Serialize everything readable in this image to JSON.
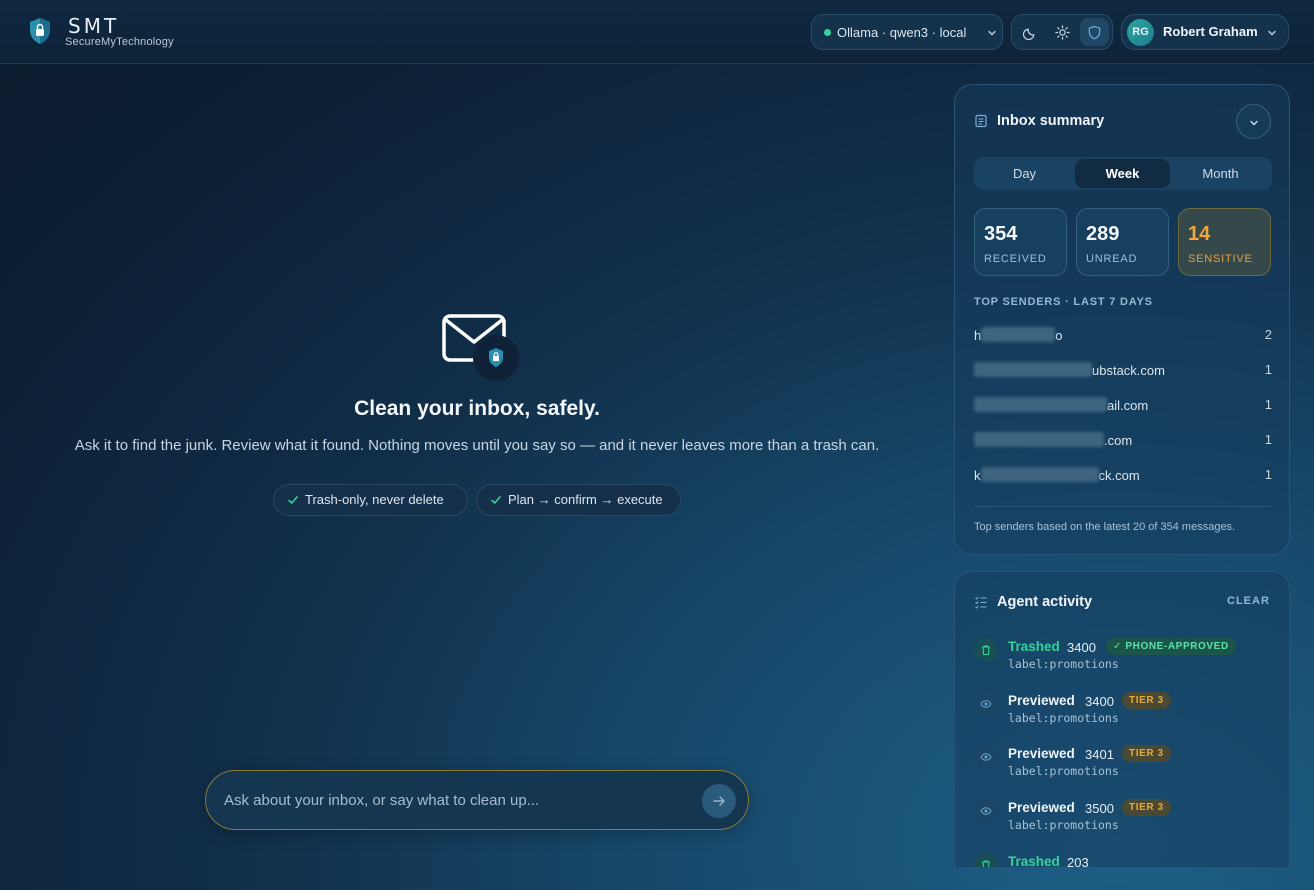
{
  "header": {
    "brand_name": "SMT",
    "brand_sub": "SecureMyTechnology",
    "model_status": "Ollama · qwen3 · local",
    "user_initials": "RG",
    "user_name": "Robert Graham"
  },
  "hero": {
    "title": "Clean your inbox, safely.",
    "subtitle": "Ask it to find the junk. Review what it found. Nothing moves until you say so — and it never leaves more than a trash can.",
    "chips": [
      "Trash-only, never delete",
      "Plan → confirm → execute"
    ]
  },
  "composer": {
    "placeholder": "Ask about your inbox, or say what to clean up..."
  },
  "summary": {
    "title": "Inbox summary",
    "tabs": [
      "Day",
      "Week",
      "Month"
    ],
    "active_tab": "Week",
    "stats": [
      {
        "value": "354",
        "label": "RECEIVED"
      },
      {
        "value": "289",
        "label": "UNREAD"
      },
      {
        "value": "14",
        "label": "SENSITIVE"
      }
    ],
    "top_senders_label": "TOP SENDERS · LAST 7 DAYS",
    "senders": [
      {
        "visible_prefix": "h",
        "visible_suffix": "o",
        "count": "2"
      },
      {
        "visible_prefix": "",
        "visible_suffix": "ubstack.com",
        "count": "1"
      },
      {
        "visible_prefix": "",
        "visible_suffix": "ail.com",
        "count": "1"
      },
      {
        "visible_prefix": "",
        "visible_suffix": ".com",
        "count": "1"
      },
      {
        "visible_prefix": "k",
        "visible_suffix": "ck.com",
        "count": "1"
      }
    ],
    "footnote": "Top senders based on the latest 20 of 354 messages."
  },
  "activity": {
    "title": "Agent activity",
    "clear_label": "CLEAR",
    "items": [
      {
        "verb": "Trashed",
        "count": "3400",
        "badge": "PHONE-APPROVED",
        "query": "label:promotions",
        "kind": "trash"
      },
      {
        "verb": "Previewed",
        "count": "3400",
        "badge": "TIER 3",
        "query": "label:promotions",
        "kind": "preview"
      },
      {
        "verb": "Previewed",
        "count": "3401",
        "badge": "TIER 3",
        "query": "label:promotions",
        "kind": "preview"
      },
      {
        "verb": "Previewed",
        "count": "3500",
        "badge": "TIER 3",
        "query": "label:promotions",
        "kind": "preview"
      },
      {
        "verb": "Trashed",
        "count": "203",
        "badge": "",
        "query": "",
        "kind": "trash"
      }
    ]
  },
  "colors": {
    "accent_green": "#34d399",
    "warning_amber": "#f0a53a",
    "background": "#0d2036"
  }
}
